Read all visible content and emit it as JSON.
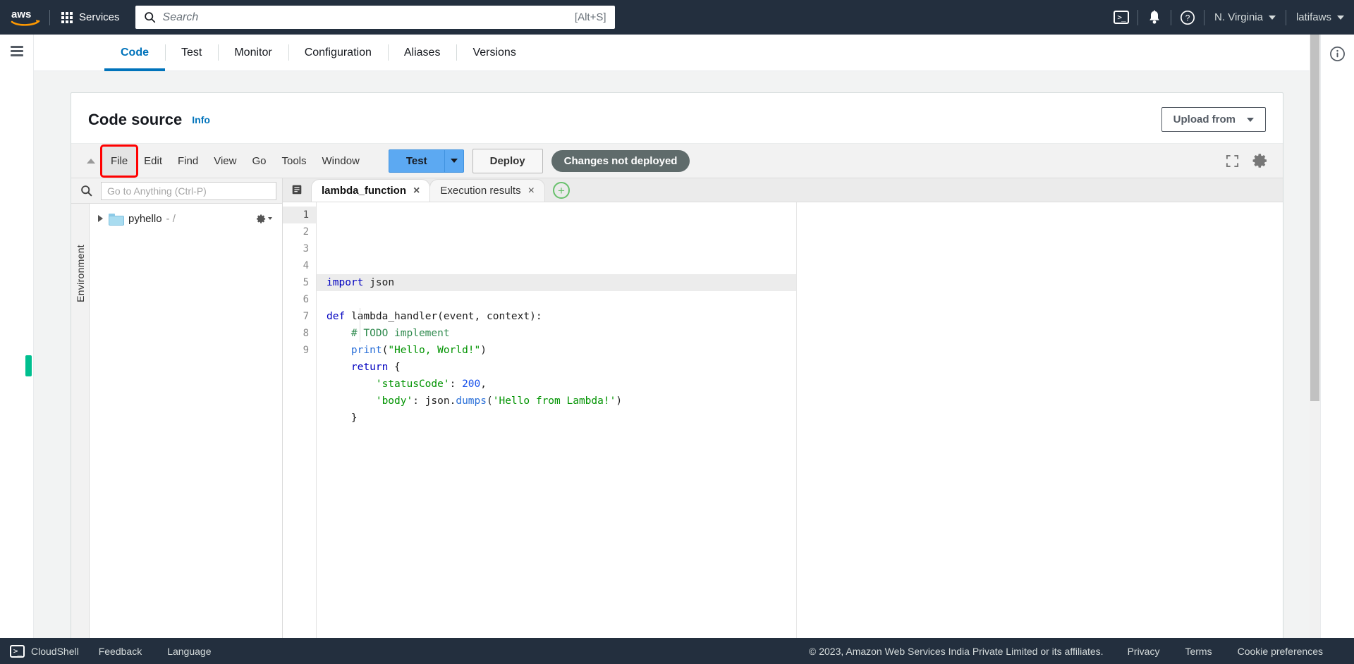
{
  "topnav": {
    "logo_alt": "aws",
    "services_label": "Services",
    "search": {
      "placeholder": "Search",
      "value": "",
      "shortcut": "[Alt+S]"
    },
    "cloudshell_icon": "cloudshell-icon",
    "notifications_icon": "bell-icon",
    "help_icon": "question-circle-icon",
    "region_label": "N. Virginia",
    "account_label": "latifaws"
  },
  "page_tabs": [
    {
      "label": "Code",
      "active": true
    },
    {
      "label": "Test",
      "active": false
    },
    {
      "label": "Monitor",
      "active": false
    },
    {
      "label": "Configuration",
      "active": false
    },
    {
      "label": "Aliases",
      "active": false
    },
    {
      "label": "Versions",
      "active": false
    }
  ],
  "panel": {
    "title": "Code source",
    "info_link": "Info",
    "upload_button": "Upload from"
  },
  "ide": {
    "menus": [
      "File",
      "Edit",
      "Find",
      "View",
      "Go",
      "Tools",
      "Window"
    ],
    "highlighted_menu": "File",
    "highlight_color": "#ff0000",
    "test_button": "Test",
    "deploy_button": "Deploy",
    "changes_badge": "Changes not deployed",
    "fullscreen_icon": "expand-icon",
    "settings_icon": "gear-icon",
    "collapse_icon": "chevron-up-icon"
  },
  "explorer": {
    "search_placeholder": "Go to Anything (Ctrl-P)",
    "search_value": "",
    "search_icon": "search-icon",
    "environment_label": "Environment",
    "tree": [
      {
        "name": "pyhello",
        "sub": "- /",
        "icon": "folder-icon",
        "expanded": false
      }
    ],
    "gear_icon": "gear-icon"
  },
  "editor": {
    "tabs_menu_icon": "tab-list-icon",
    "tabs": [
      {
        "label": "lambda_function",
        "active": true,
        "close": "×"
      },
      {
        "label": "Execution results",
        "active": false,
        "close": "×"
      }
    ],
    "add_tab_icon": "plus-circle-icon",
    "line_numbers": [
      "1",
      "2",
      "3",
      "4",
      "5",
      "6",
      "7",
      "8",
      "9"
    ],
    "active_line": 1,
    "code_lines": [
      [
        {
          "t": "import",
          "c": "k"
        },
        {
          "t": " ",
          "c": "id"
        },
        {
          "t": "json",
          "c": "id"
        }
      ],
      [],
      [
        {
          "t": "def",
          "c": "k"
        },
        {
          "t": " ",
          "c": "id"
        },
        {
          "t": "lambda_handler",
          "c": "fn"
        },
        {
          "t": "(event, context):",
          "c": "id"
        }
      ],
      [
        {
          "t": "    ",
          "c": "id"
        },
        {
          "t": "# TODO implement",
          "c": "cm"
        }
      ],
      [
        {
          "t": "    ",
          "c": "id"
        },
        {
          "t": "print",
          "c": "mt"
        },
        {
          "t": "(",
          "c": "id"
        },
        {
          "t": "\"Hello, World!\"",
          "c": "st"
        },
        {
          "t": ")",
          "c": "id"
        }
      ],
      [
        {
          "t": "    ",
          "c": "id"
        },
        {
          "t": "return",
          "c": "k"
        },
        {
          "t": " {",
          "c": "id"
        }
      ],
      [
        {
          "t": "        ",
          "c": "id"
        },
        {
          "t": "'statusCode'",
          "c": "st"
        },
        {
          "t": ": ",
          "c": "id"
        },
        {
          "t": "200",
          "c": "nu"
        },
        {
          "t": ",",
          "c": "id"
        }
      ],
      [
        {
          "t": "        ",
          "c": "id"
        },
        {
          "t": "'body'",
          "c": "st"
        },
        {
          "t": ": json.",
          "c": "id"
        },
        {
          "t": "dumps",
          "c": "mt"
        },
        {
          "t": "(",
          "c": "id"
        },
        {
          "t": "'Hello from Lambda!'",
          "c": "st"
        },
        {
          "t": ")",
          "c": "id"
        }
      ],
      [
        {
          "t": "    }",
          "c": "id"
        }
      ]
    ]
  },
  "right_rail": {
    "info_icon": "info-circle-icon"
  },
  "left_rail": {
    "menu_icon": "hamburger-icon"
  },
  "scrollbar": {
    "marker_color": "#00bf8f"
  },
  "footer": {
    "cloudshell": "CloudShell",
    "feedback": "Feedback",
    "language": "Language",
    "copyright": "© 2023, Amazon Web Services India Private Limited or its affiliates.",
    "privacy": "Privacy",
    "terms": "Terms",
    "cookies": "Cookie preferences"
  }
}
